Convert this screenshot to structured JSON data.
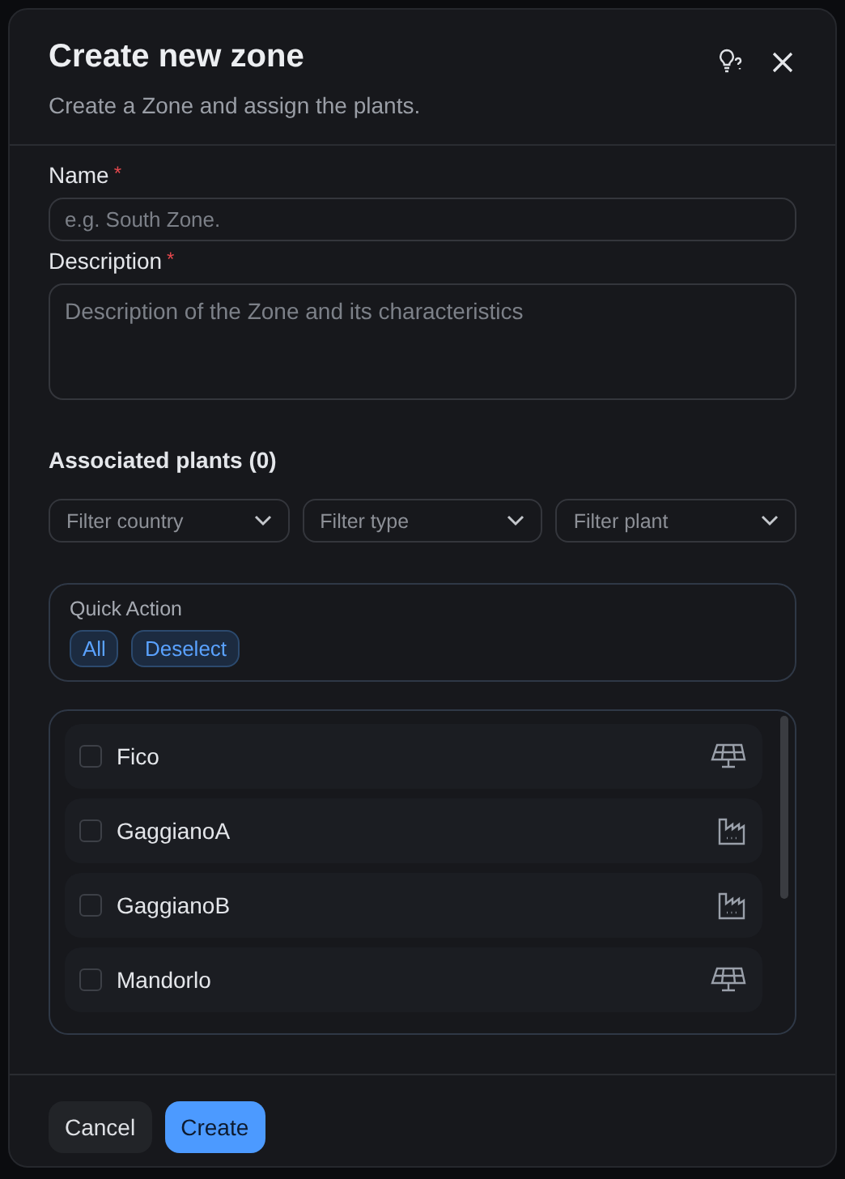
{
  "dialog": {
    "title": "Create new zone",
    "subtitle": "Create a Zone and assign the plants."
  },
  "fields": [
    {
      "label": "Name",
      "required_mark": "*",
      "kind": "input",
      "placeholder": "e.g. South Zone."
    },
    {
      "label": "Description",
      "required_mark": "*",
      "kind": "textarea",
      "placeholder": "Description of the Zone and its characteristics"
    }
  ],
  "plants_section": {
    "title": "Associated plants (0)"
  },
  "filters": [
    {
      "placeholder": "Filter country"
    },
    {
      "placeholder": "Filter type"
    },
    {
      "placeholder": "Filter plant"
    }
  ],
  "quick_action": {
    "title": "Quick Action",
    "buttons": [
      "All",
      "Deselect"
    ]
  },
  "plants": [
    {
      "name": "Fico",
      "checked": false,
      "kind": "solar"
    },
    {
      "name": "GaggianoA",
      "checked": false,
      "kind": "factory"
    },
    {
      "name": "GaggianoB",
      "checked": false,
      "kind": "factory"
    },
    {
      "name": "Mandorlo",
      "checked": false,
      "kind": "solar"
    }
  ],
  "footer": {
    "buttons": [
      {
        "label": "Cancel",
        "kind": "secondary"
      },
      {
        "label": "Create",
        "kind": "primary"
      }
    ]
  }
}
